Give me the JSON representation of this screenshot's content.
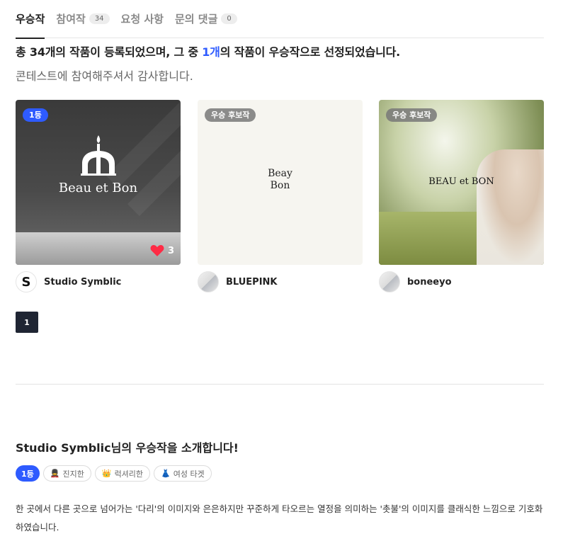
{
  "tabs": [
    {
      "label": "우승작",
      "count": null,
      "active": true
    },
    {
      "label": "참여작",
      "count": "34",
      "active": false
    },
    {
      "label": "요청 사항",
      "count": null,
      "active": false
    },
    {
      "label": "문의 댓글",
      "count": "0",
      "active": false
    }
  ],
  "summary": {
    "before": "총 34개의 작품이 등록되었으며, 그 중 ",
    "highlight": "1개",
    "after": "의 작품이 우승작으로 선정되었습니다."
  },
  "thanks": "콘테스트에 참여해주셔서 감사합니다.",
  "entries": [
    {
      "badge": "1등",
      "image_text": "Beau et Bon",
      "likes": "3",
      "author": "Studio Symblic",
      "avatar_letter": "S"
    },
    {
      "badge": "우승 후보작",
      "image_text_line1": "Beay",
      "image_text_line2": "Bon",
      "author": "BLUEPINK"
    },
    {
      "badge": "우승 후보작",
      "image_text": "BEAU et BON",
      "author": "boneeyo"
    }
  ],
  "pagination": {
    "current": "1"
  },
  "winner": {
    "title": "Studio Symblic님의 우승작을 소개합니다!",
    "rank": "1등",
    "tags": [
      {
        "icon": "guard-icon",
        "emoji": "💂",
        "label": "진지한"
      },
      {
        "icon": "crown-icon",
        "emoji": "👑",
        "label": "럭셔리한"
      },
      {
        "icon": "dress-icon",
        "emoji": "👗",
        "label": "여성 타겟"
      }
    ],
    "description": "한 곳에서 다른 곳으로 넘어가는 '다리'의 이미지와 은은하지만 꾸준하게 타오르는 열정을 의미하는 '촛불'의 이미지를 클래식한 느낌으로 기호화하였습니다."
  },
  "colors": {
    "accent": "#2e5bff",
    "pager": "#1f2533",
    "like": "#ff2b45"
  }
}
